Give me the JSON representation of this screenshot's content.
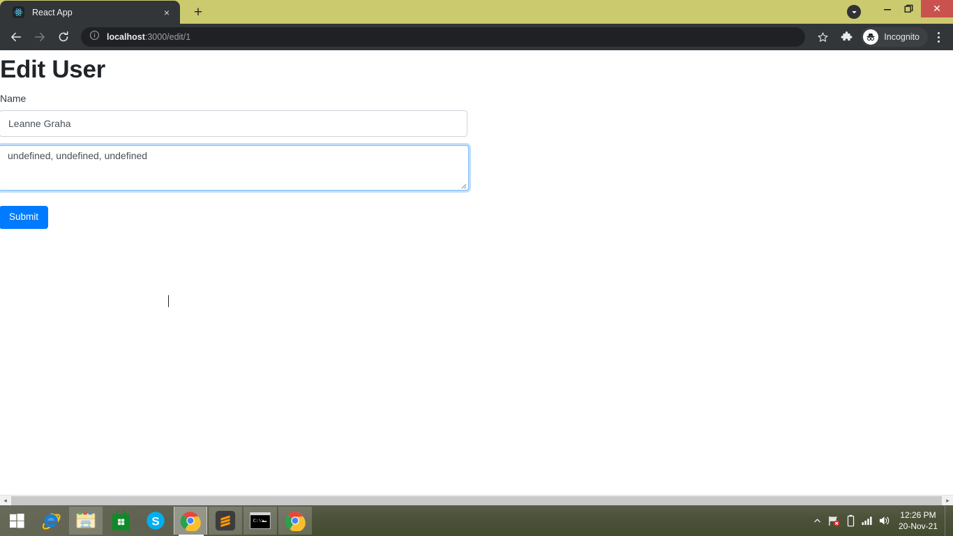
{
  "browser": {
    "tab": {
      "title": "React App",
      "favicon": "react-logo-icon",
      "close_label": "×"
    },
    "new_tab_label": "+",
    "tab_search_icon": "chevron-down-circle-icon",
    "window_controls": {
      "minimize_label": "–",
      "maximize_label": "restore-icon",
      "close_label": "✕"
    },
    "toolbar": {
      "back_icon": "arrow-left-icon",
      "forward_icon": "arrow-right-icon",
      "reload_icon": "reload-icon",
      "site_info_icon": "info-circle-icon",
      "url_host": "localhost",
      "url_rest": ":3000/edit/1",
      "url_full": "localhost:3000/edit/1",
      "bookmark_icon": "star-icon",
      "extensions_icon": "puzzle-piece-icon",
      "profile_label": "Incognito",
      "profile_icon": "incognito-hat-icon",
      "menu_icon": "three-dots-vertical-icon"
    },
    "scrollbar": {
      "left_arrow": "◂",
      "right_arrow": "▸"
    }
  },
  "page": {
    "title": "Edit User",
    "name_label": "Name",
    "name_value": "Leanne Graha",
    "name_placeholder": "",
    "details_value": "undefined, undefined, undefined",
    "details_placeholder": "",
    "submit_label": "Submit",
    "colors": {
      "primary": "#007bff",
      "focus_ring": "#80bdff",
      "border": "#ced4da",
      "text": "#495057",
      "heading": "#212529"
    }
  },
  "taskbar": {
    "start_icon": "windows-start-icon",
    "items": [
      {
        "name": "internet-explorer",
        "icon": "internet-explorer-icon",
        "active": false,
        "pinned_bg": false
      },
      {
        "name": "file-explorer",
        "icon": "file-explorer-icon",
        "active": false,
        "pinned_bg": true
      },
      {
        "name": "microsoft-store",
        "icon": "microsoft-store-icon",
        "active": false,
        "pinned_bg": false
      },
      {
        "name": "skype",
        "icon": "skype-icon",
        "active": false,
        "pinned_bg": false
      },
      {
        "name": "google-chrome-active",
        "icon": "google-chrome-icon",
        "active": true,
        "pinned_bg": false
      },
      {
        "name": "sublime-text",
        "icon": "sublime-text-icon",
        "active": false,
        "pinned_bg": true
      },
      {
        "name": "command-prompt",
        "icon": "command-prompt-icon",
        "active": false,
        "pinned_bg": true
      },
      {
        "name": "google-chrome-second",
        "icon": "google-chrome-icon",
        "active": false,
        "pinned_bg": true
      }
    ],
    "tray": {
      "show_hidden_icon": "chevron-up-icon",
      "network_icon": "network-flag-error-icon",
      "battery_icon": "battery-icon",
      "signal_icon": "signal-bars-icon",
      "volume_icon": "speaker-icon",
      "time": "12:26 PM",
      "date": "20-Nov-21"
    }
  }
}
